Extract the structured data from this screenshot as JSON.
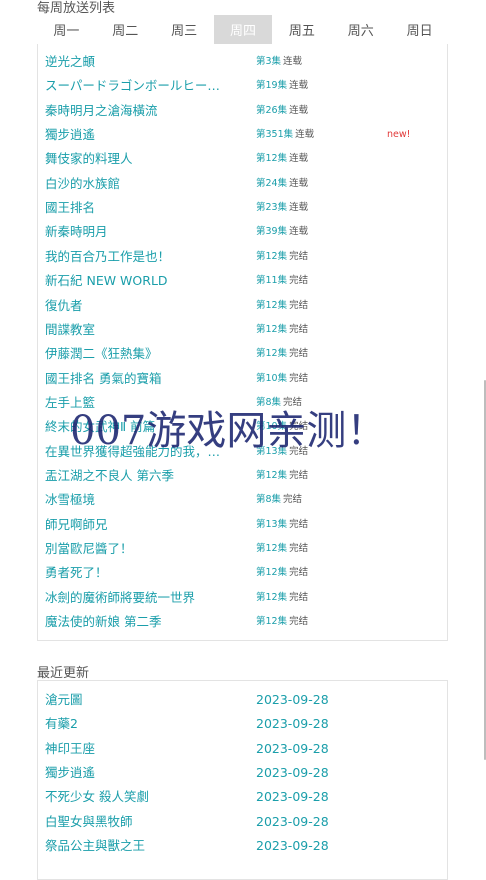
{
  "weekly": {
    "title": "每周放送列表",
    "days": [
      "周一",
      "周二",
      "周三",
      "周四",
      "周五",
      "周六",
      "周日"
    ],
    "active_day": "周四",
    "items": [
      {
        "title": "逆光之頔",
        "episode": "第3集",
        "status": "连载",
        "new": ""
      },
      {
        "title": "スーパードラゴンボールヒーローズ",
        "episode": "第19集",
        "status": "连载",
        "new": ""
      },
      {
        "title": "秦時明月之滄海橫流",
        "episode": "第26集",
        "status": "连载",
        "new": ""
      },
      {
        "title": "獨步逍遙",
        "episode": "第351集",
        "status": "连载",
        "new": "new!"
      },
      {
        "title": "舞伎家的料理人",
        "episode": "第12集",
        "status": "连载",
        "new": ""
      },
      {
        "title": "白沙的水族館",
        "episode": "第24集",
        "status": "连载",
        "new": ""
      },
      {
        "title": "國王排名",
        "episode": "第23集",
        "status": "连载",
        "new": ""
      },
      {
        "title": "新秦時明月",
        "episode": "第39集",
        "status": "连载",
        "new": ""
      },
      {
        "title": "我的百合乃工作是也！",
        "episode": "第12集",
        "status": "完结",
        "new": ""
      },
      {
        "title": "新石紀 NEW WORLD",
        "episode": "第11集",
        "status": "完结",
        "new": ""
      },
      {
        "title": "復仇者",
        "episode": "第12集",
        "status": "完结",
        "new": ""
      },
      {
        "title": "間諜教室",
        "episode": "第12集",
        "status": "完结",
        "new": ""
      },
      {
        "title": "伊藤潤二《狂熱集》",
        "episode": "第12集",
        "status": "完结",
        "new": ""
      },
      {
        "title": "國王排名 勇氣的寶箱",
        "episode": "第10集",
        "status": "完结",
        "new": ""
      },
      {
        "title": "左手上籃",
        "episode": "第8集",
        "status": "完结",
        "new": ""
      },
      {
        "title": "終末的女武神Ⅱ 前篇",
        "episode": "第10集",
        "status": "完结",
        "new": ""
      },
      {
        "title": "在異世界獲得超強能力的我，在現實世界照樣無敵",
        "episode": "第13集",
        "status": "完结",
        "new": ""
      },
      {
        "title": "盂江湖之不良人 第六季",
        "episode": "第12集",
        "status": "完结",
        "new": ""
      },
      {
        "title": "冰雪極境",
        "episode": "第8集",
        "status": "完结",
        "new": ""
      },
      {
        "title": "師兄啊師兄",
        "episode": "第13集",
        "status": "完结",
        "new": ""
      },
      {
        "title": "別當歐尼醬了！",
        "episode": "第12集",
        "status": "完结",
        "new": ""
      },
      {
        "title": "勇者死了！",
        "episode": "第12集",
        "status": "完结",
        "new": ""
      },
      {
        "title": "冰劍的魔術師將要統一世界",
        "episode": "第12集",
        "status": "完结",
        "new": ""
      },
      {
        "title": "魔法使的新娘 第二季",
        "episode": "第12集",
        "status": "完结",
        "new": ""
      }
    ]
  },
  "recent": {
    "title": "最近更新",
    "items": [
      {
        "title": "滄元圖",
        "date": "2023-09-28"
      },
      {
        "title": "有藥2",
        "date": "2023-09-28"
      },
      {
        "title": "神印王座",
        "date": "2023-09-28"
      },
      {
        "title": "獨步逍遙",
        "date": "2023-09-28"
      },
      {
        "title": "不死少女 殺人笑劇",
        "date": "2023-09-28"
      },
      {
        "title": "白聖女與黑牧師",
        "date": "2023-09-28"
      },
      {
        "title": "祭品公主與獸之王",
        "date": "2023-09-28"
      }
    ]
  },
  "watermark": "007游戏网亲测！",
  "colors": {
    "link": "#1a9eaa",
    "new_badge": "#e23a3a",
    "active_tab": "#d9d9d9"
  }
}
